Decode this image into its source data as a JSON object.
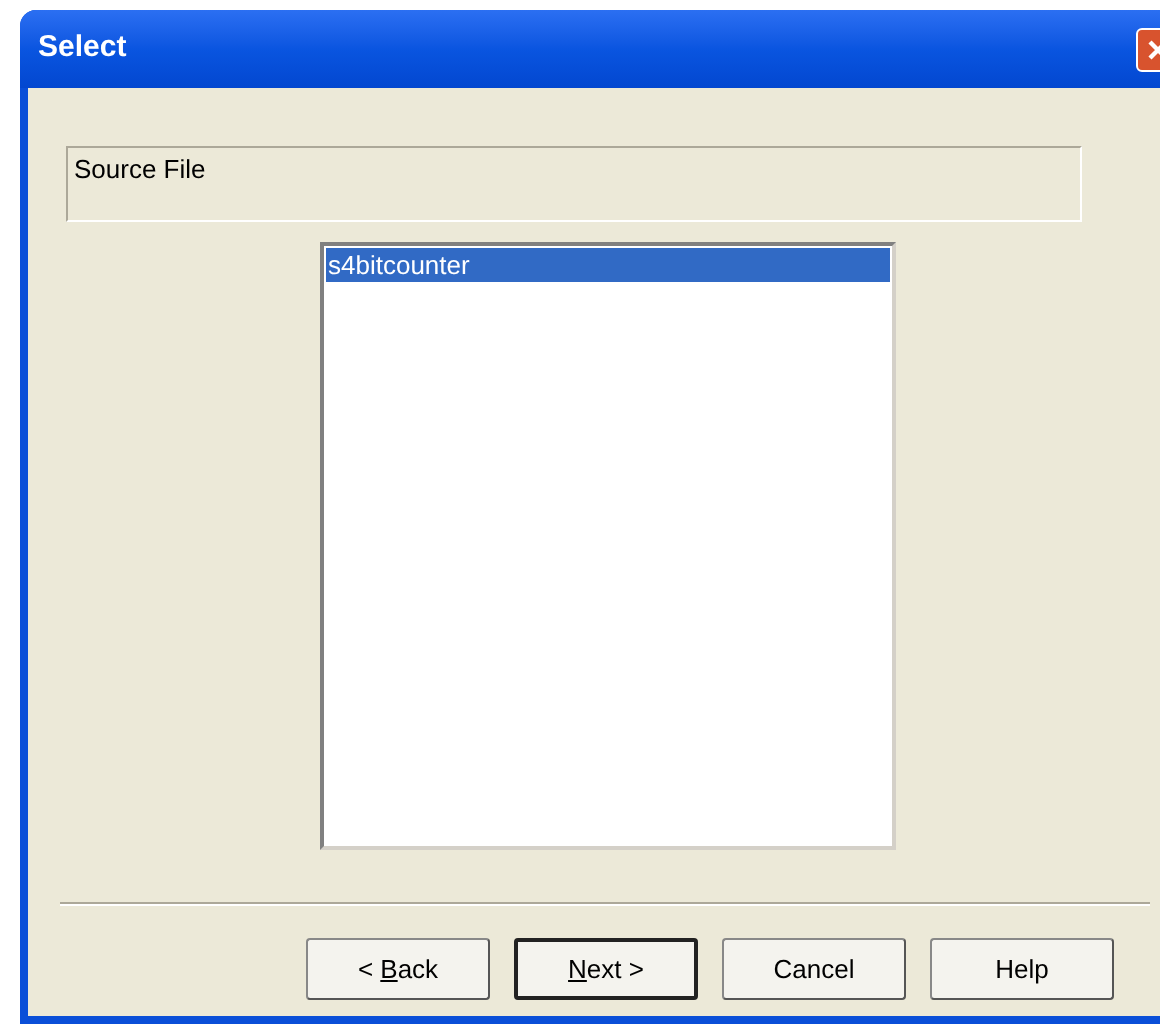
{
  "window": {
    "title": "Select"
  },
  "group": {
    "label": "Source File"
  },
  "list": {
    "items": [
      {
        "label": "s4bitcounter",
        "selected": true
      }
    ]
  },
  "buttons": [
    {
      "before": "< ",
      "key": "B",
      "after": "ack",
      "default": false
    },
    {
      "key": "N",
      "after": "ext >",
      "default": true
    },
    {
      "before": "Cancel",
      "default": false
    },
    {
      "before": "Help",
      "default": false
    }
  ]
}
